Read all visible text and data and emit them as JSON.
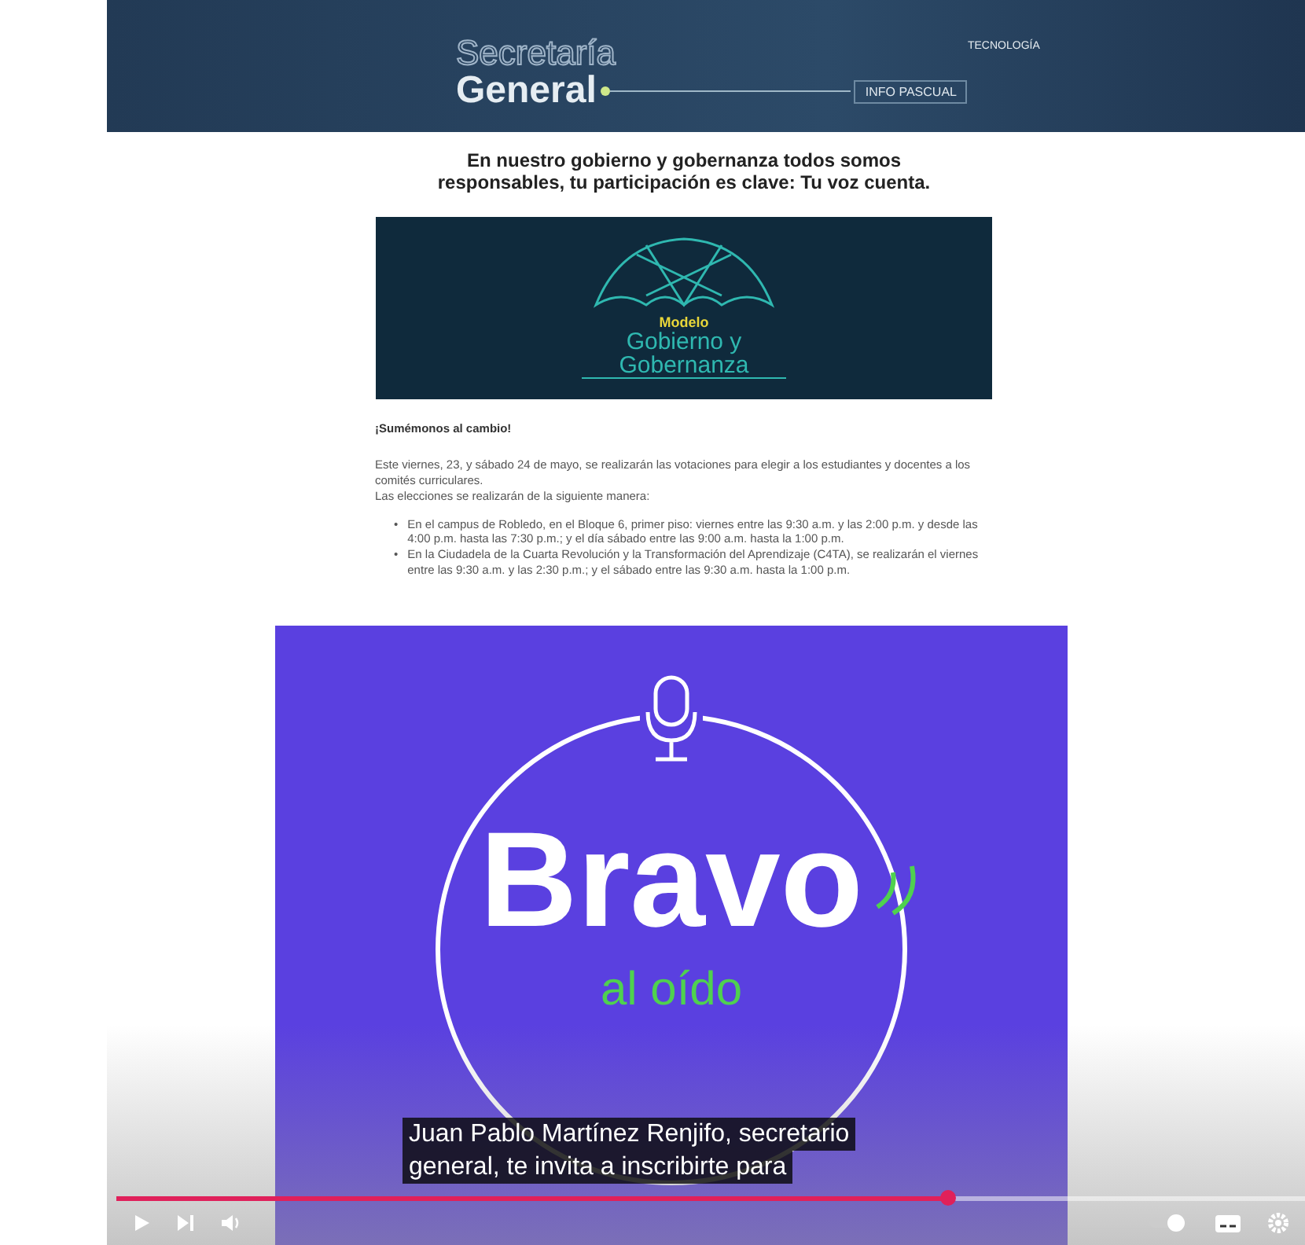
{
  "header": {
    "title_outline": "Secretaría",
    "title": "General",
    "tag": "INFO PASCUAL",
    "logo_text": "TECNOLOGÍA"
  },
  "headline": "En nuestro gobierno y gobernanza todos somos responsables, tu participación es clave: Tu voz cuenta.",
  "banner": {
    "label": "Modelo",
    "title": "Gobierno y Gobernanza"
  },
  "article": {
    "heading": "¡Sumémonos al cambio!",
    "paragraphs": [
      "Este viernes, 23, y sábado 24 de mayo, se realizarán las votaciones para elegir a los estudiantes y docentes a los comités curriculares.",
      "Las elecciones se realizarán de la siguiente manera:"
    ],
    "bullets": [
      {
        "marker": "•",
        "text": "En el campus de Robledo, en el Bloque 6, primer piso: viernes entre las 9:30 a.m. y las 2:00 p.m. y desde las 4:00 p.m. hasta las 7:30 p.m.; y el día sábado entre las 9:00 a.m. hasta la 1:00 p.m."
      },
      {
        "marker": "•",
        "text": "En la Ciudadela de la Cuarta Revolución y la Transformación del Aprendizaje (C4TA), se realizarán el viernes entre las 9:30 a.m. y las 2:30 p.m.; y el sábado entre las 9:30 a.m. hasta la 1:00 p.m."
      }
    ]
  },
  "podcast": {
    "title": "Bravo",
    "subtitle": "al oído"
  },
  "player": {
    "captions": [
      "Juan Pablo Martínez Renjifo, secretario",
      "general, te invita a inscribirte para"
    ],
    "progress": {
      "level": 0.7
    }
  }
}
